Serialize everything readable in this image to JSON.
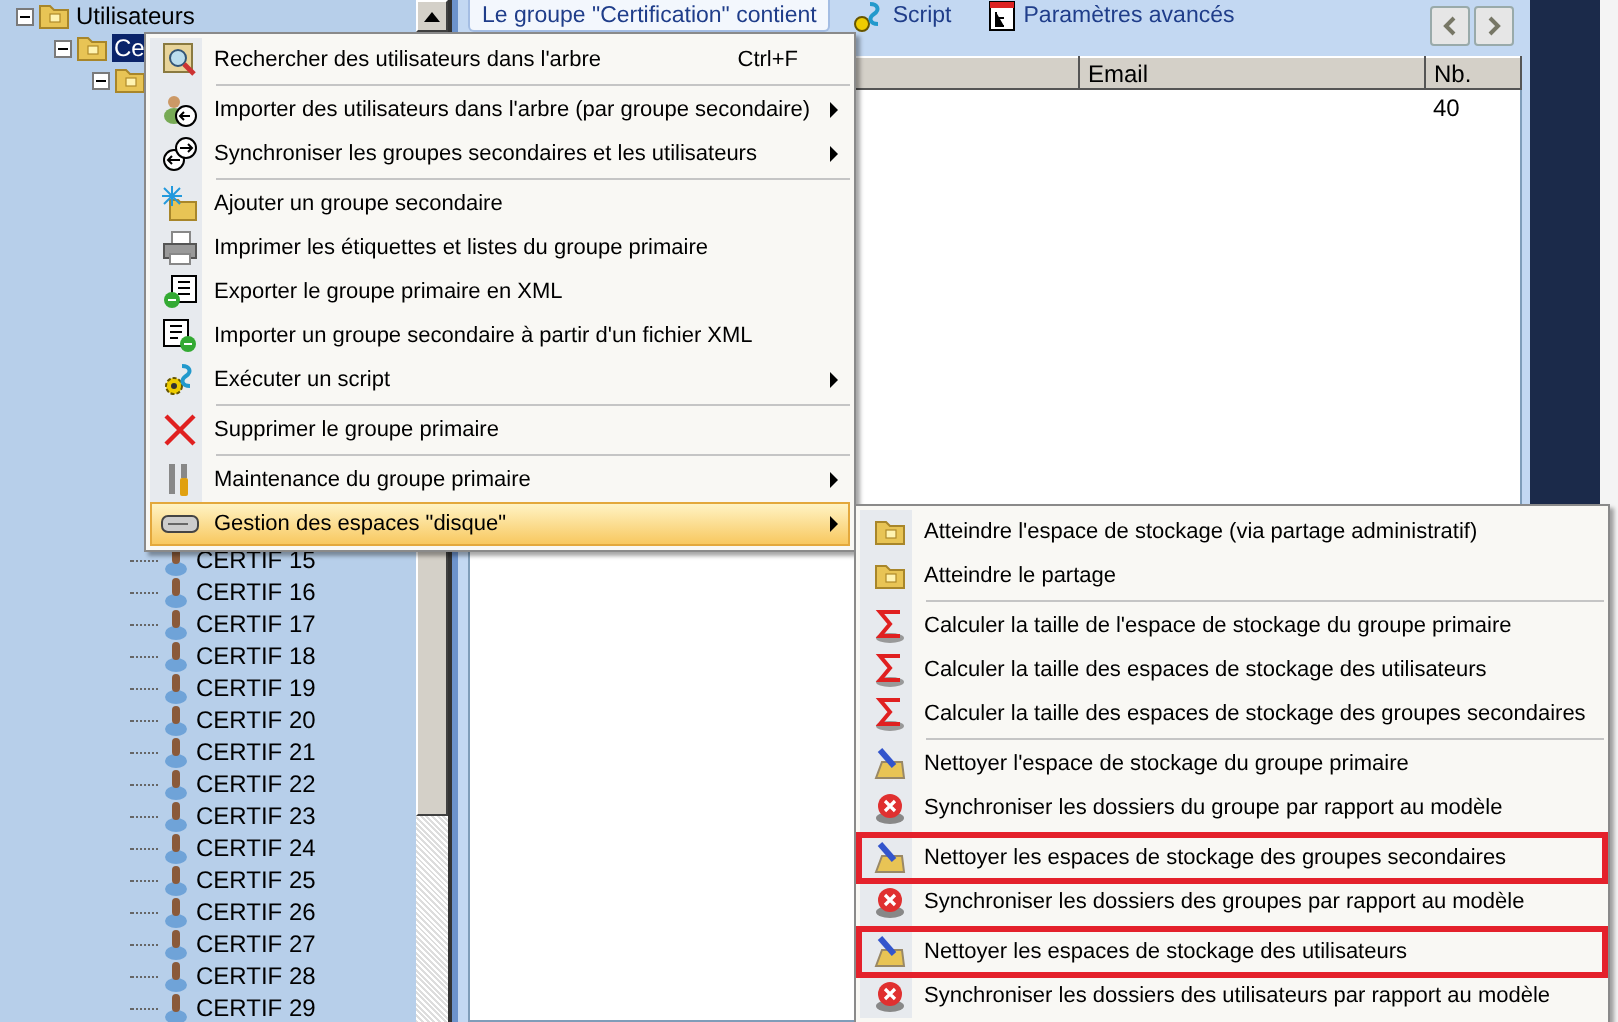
{
  "tree": {
    "items": [
      {
        "label": "Utilisateurs",
        "kind": "folder",
        "expanded": true,
        "selected": false,
        "children": [
          {
            "label": "Ce",
            "kind": "folder",
            "expanded": true,
            "selected": true,
            "children": [
              {
                "kind": "folder",
                "expanded": true,
                "children": [
                  {
                    "label": "CERTIF 15",
                    "kind": "user",
                    "selected": false
                  },
                  {
                    "label": "CERTIF 16",
                    "kind": "user",
                    "selected": false
                  },
                  {
                    "label": "CERTIF 17",
                    "kind": "user",
                    "selected": false
                  },
                  {
                    "label": "CERTIF 18",
                    "kind": "user",
                    "selected": false
                  },
                  {
                    "label": "CERTIF 19",
                    "kind": "user",
                    "selected": false
                  },
                  {
                    "label": "CERTIF 20",
                    "kind": "user",
                    "selected": false
                  },
                  {
                    "label": "CERTIF 21",
                    "kind": "user",
                    "selected": false
                  },
                  {
                    "label": "CERTIF 22",
                    "kind": "user",
                    "selected": false
                  },
                  {
                    "label": "CERTIF 23",
                    "kind": "user",
                    "selected": false
                  },
                  {
                    "label": "CERTIF 24",
                    "kind": "user",
                    "selected": false
                  },
                  {
                    "label": "CERTIF 25",
                    "kind": "user",
                    "selected": false
                  },
                  {
                    "label": "CERTIF 26",
                    "kind": "user",
                    "selected": false
                  },
                  {
                    "label": "CERTIF 27",
                    "kind": "user",
                    "selected": false
                  },
                  {
                    "label": "CERTIF 28",
                    "kind": "user",
                    "selected": false
                  },
                  {
                    "label": "CERTIF 29",
                    "kind": "user",
                    "selected": false
                  }
                ]
              }
            ]
          }
        ]
      }
    ]
  },
  "tabs": [
    {
      "label": "Le groupe \"Certification\" contient",
      "selected": true
    },
    {
      "label": "Script",
      "selected": false
    },
    {
      "label": "Paramètres avancés",
      "selected": false
    }
  ],
  "table": {
    "headers": {
      "column_2": "Email",
      "column_3": "Nb."
    },
    "rows": [
      {
        "column_3": "40"
      }
    ]
  },
  "menu": {
    "items": [
      {
        "kind": "item",
        "label": "Rechercher des utilisateurs dans l'arbre",
        "shortcut": "Ctrl+F",
        "submenu": false,
        "selected": false
      },
      {
        "kind": "separator"
      },
      {
        "kind": "item",
        "label": "Importer des utilisateurs dans l'arbre (par groupe secondaire)",
        "submenu": true,
        "selected": false
      },
      {
        "kind": "item",
        "label": "Synchroniser les groupes secondaires et les utilisateurs",
        "submenu": true,
        "selected": false
      },
      {
        "kind": "separator"
      },
      {
        "kind": "item",
        "label": "Ajouter un groupe secondaire",
        "submenu": false,
        "selected": false
      },
      {
        "kind": "item",
        "label": "Imprimer les étiquettes et listes du groupe primaire",
        "submenu": false,
        "selected": false
      },
      {
        "kind": "item",
        "label": "Exporter le groupe primaire en XML",
        "submenu": false,
        "selected": false
      },
      {
        "kind": "item",
        "label": "Importer un groupe secondaire à partir d'un fichier XML",
        "submenu": false,
        "selected": false
      },
      {
        "kind": "item",
        "label": "Exécuter un script",
        "submenu": true,
        "selected": false
      },
      {
        "kind": "separator"
      },
      {
        "kind": "item",
        "label": "Supprimer le groupe primaire",
        "submenu": false,
        "selected": false
      },
      {
        "kind": "separator"
      },
      {
        "kind": "item",
        "label": "Maintenance du groupe primaire",
        "submenu": true,
        "selected": false
      },
      {
        "kind": "item",
        "label": "Gestion des espaces \"disque\"",
        "submenu": true,
        "selected": true
      }
    ]
  },
  "submenu": {
    "items": [
      {
        "kind": "item",
        "label": "Atteindre l'espace de stockage (via partage administratif)",
        "highlighted": false
      },
      {
        "kind": "item",
        "label": "Atteindre le partage",
        "highlighted": false
      },
      {
        "kind": "separator"
      },
      {
        "kind": "item",
        "label": "Calculer la taille de l'espace de stockage du groupe primaire",
        "highlighted": false
      },
      {
        "kind": "item",
        "label": "Calculer la taille des espaces de stockage des utilisateurs",
        "highlighted": false
      },
      {
        "kind": "item",
        "label": "Calculer la taille des espaces de stockage des groupes secondaires",
        "highlighted": false
      },
      {
        "kind": "separator"
      },
      {
        "kind": "item",
        "label": "Nettoyer l'espace de stockage du groupe primaire",
        "highlighted": false
      },
      {
        "kind": "item",
        "label": "Synchroniser les dossiers du groupe par rapport au modèle",
        "highlighted": false
      },
      {
        "kind": "separator"
      },
      {
        "kind": "item",
        "label": "Nettoyer les espaces de stockage des groupes secondaires",
        "highlighted": true
      },
      {
        "kind": "item",
        "label": "Synchroniser les dossiers des groupes par rapport au modèle",
        "highlighted": false
      },
      {
        "kind": "separator"
      },
      {
        "kind": "item",
        "label": "Nettoyer les espaces de stockage des utilisateurs",
        "highlighted": true
      },
      {
        "kind": "item",
        "label": "Synchroniser les dossiers des utilisateurs par rapport au modèle",
        "highlighted": false
      }
    ]
  }
}
